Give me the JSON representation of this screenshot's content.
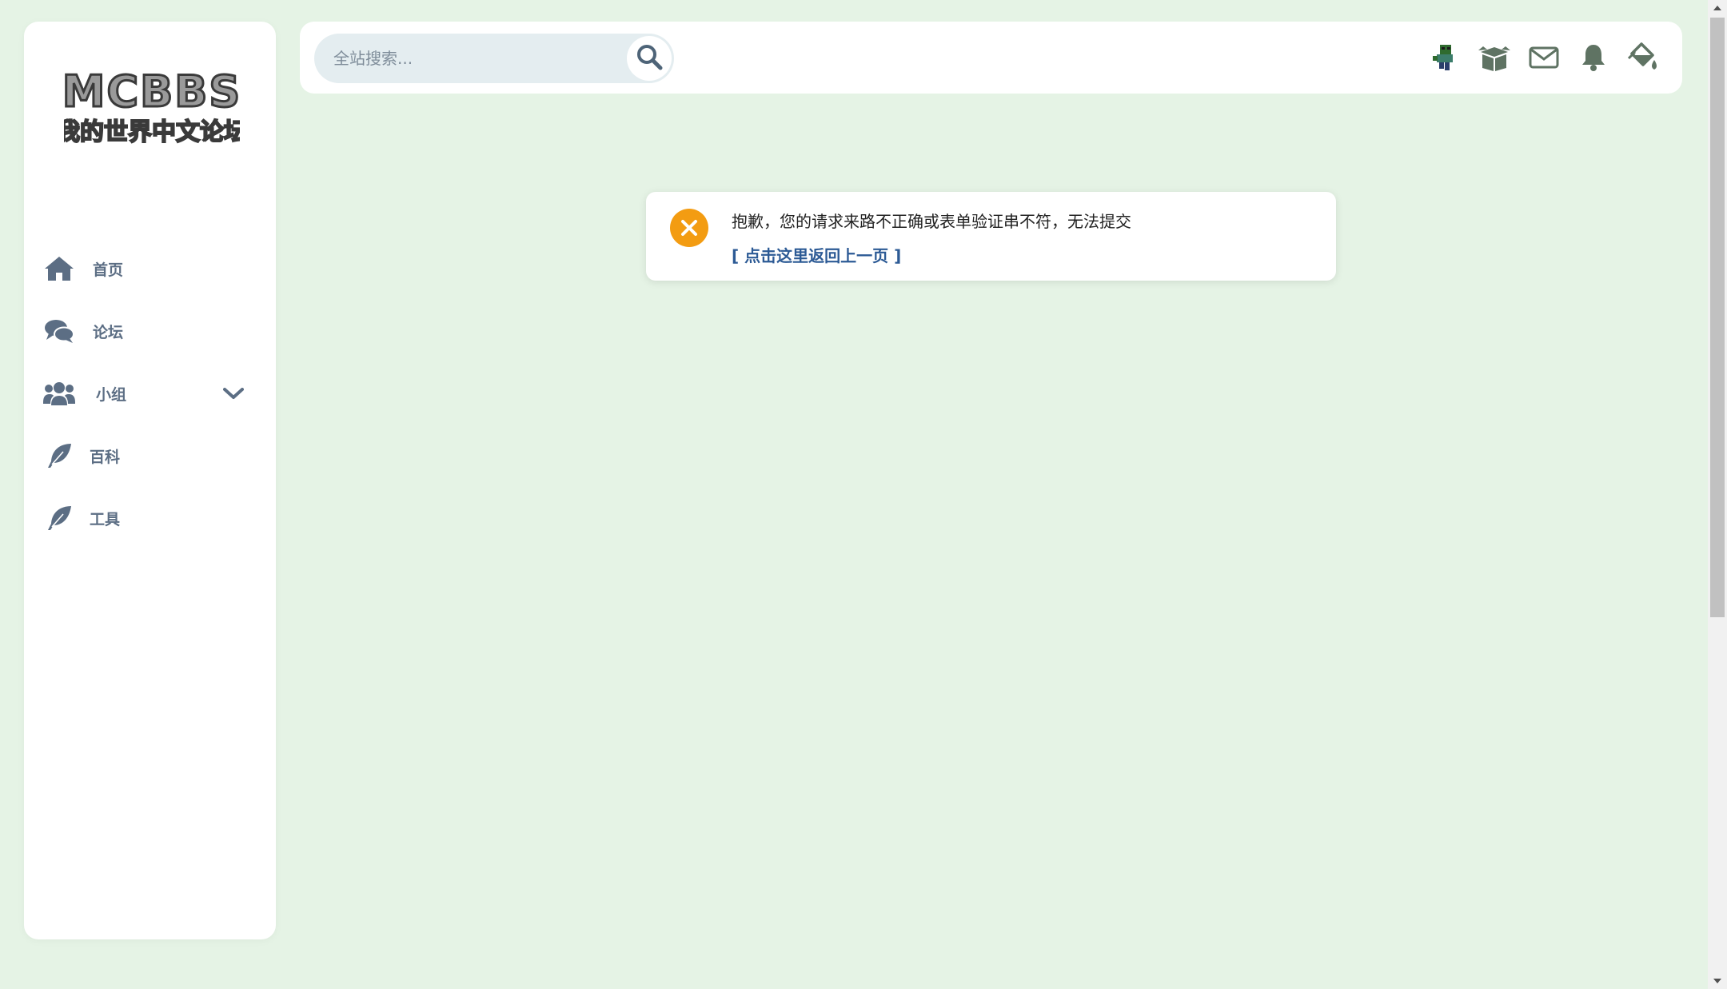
{
  "logo": {
    "line1": "MCBBS",
    "line2": "我的世界中文论坛"
  },
  "search": {
    "placeholder": "全站搜索..."
  },
  "sidebar": {
    "items": [
      {
        "label": "首页",
        "icon": "home-icon"
      },
      {
        "label": "论坛",
        "icon": "comments-icon"
      },
      {
        "label": "小组",
        "icon": "users-icon",
        "expandable": true
      },
      {
        "label": "百科",
        "icon": "feather-icon"
      },
      {
        "label": "工具",
        "icon": "feather-icon"
      }
    ]
  },
  "topbar": {
    "icons": [
      "avatar-icon",
      "box-icon",
      "mail-icon",
      "bell-icon",
      "paint-bucket-icon"
    ]
  },
  "alert": {
    "message": "抱歉，您的请求来路不正确或表单验证串不符，无法提交",
    "back_link": "[ 点击这里返回上一页 ]",
    "icon_color": "#f39c12"
  },
  "colors": {
    "background": "#e5f3e5",
    "panel": "#ffffff",
    "nav_text": "#5c6e84",
    "link": "#2c5a95",
    "icon": "#5f7363"
  }
}
